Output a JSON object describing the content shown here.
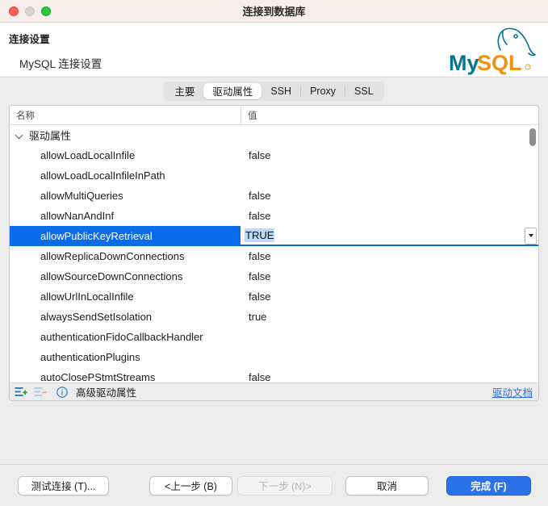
{
  "window": {
    "title": "连接到数据库",
    "traffic_lights": [
      "close-button",
      "minimize-button",
      "maximize-button"
    ]
  },
  "banner": {
    "title": "连接设置",
    "subtitle": "MySQL 连接设置",
    "logo_text_primary": "My",
    "logo_text_secondary": "SQL",
    "logo_colors": {
      "primary": "#00758f",
      "secondary": "#f29111"
    }
  },
  "tabs": [
    {
      "label": "主要",
      "active": false
    },
    {
      "label": "驱动属性",
      "active": true
    },
    {
      "label": "SSH",
      "active": false
    },
    {
      "label": "Proxy",
      "active": false
    },
    {
      "label": "SSL",
      "active": false
    }
  ],
  "table": {
    "columns": [
      "名称",
      "值"
    ],
    "group_row": {
      "label": "驱动属性",
      "expanded": true
    },
    "rows": [
      {
        "name": "allowLoadLocalInfile",
        "value": "false"
      },
      {
        "name": "allowLoadLocalInfileInPath",
        "value": ""
      },
      {
        "name": "allowMultiQueries",
        "value": "false"
      },
      {
        "name": "allowNanAndInf",
        "value": "false"
      },
      {
        "name": "allowPublicKeyRetrieval",
        "value": "TRUE",
        "selected": true,
        "editing": true
      },
      {
        "name": "allowReplicaDownConnections",
        "value": "false"
      },
      {
        "name": "allowSourceDownConnections",
        "value": "false"
      },
      {
        "name": "allowUrlInLocalInfile",
        "value": "false"
      },
      {
        "name": "alwaysSendSetIsolation",
        "value": "true"
      },
      {
        "name": "authenticationFidoCallbackHandler",
        "value": ""
      },
      {
        "name": "authenticationPlugins",
        "value": ""
      },
      {
        "name": "autoClosePStmtStreams",
        "value": "false"
      }
    ],
    "editor_value": "TRUE",
    "selection_color": "#0a6ce8"
  },
  "panel_footer": {
    "add_icon": "add-property-icon",
    "remove_icon": "remove-property-icon",
    "info_icon": "info-icon",
    "advanced_label": "高级驱动属性",
    "doc_link": "驱动文档",
    "link_color": "#2a6fe0"
  },
  "buttons": {
    "test": "测试连接 (T)...",
    "prev": "<上一步 (B)",
    "next": "下一步 (N)>",
    "cancel": "取消",
    "finish": "完成 (F)",
    "next_disabled": true,
    "finish_color": "#2a72e8"
  }
}
